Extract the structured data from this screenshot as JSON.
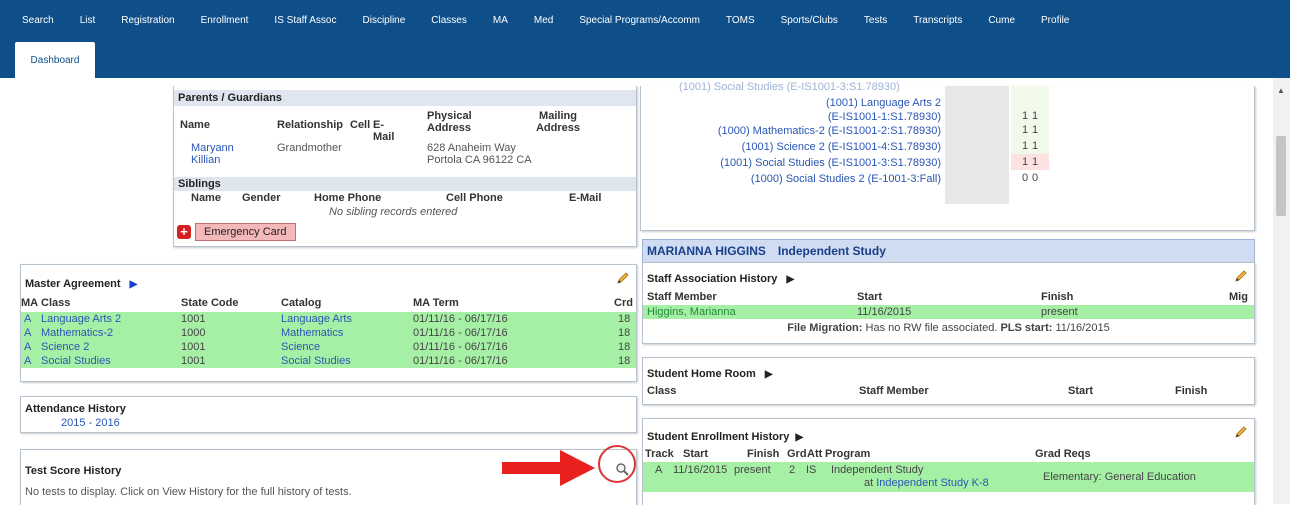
{
  "nav": {
    "items": [
      "Search",
      "List",
      "Registration",
      "Enrollment",
      "IS Staff Assoc",
      "Discipline",
      "Classes",
      "MA",
      "Med",
      "Special Programs/Accomm",
      "TOMS",
      "Sports/Clubs",
      "Tests",
      "Transcripts",
      "Cume",
      "Profile"
    ],
    "active_tab": "Dashboard"
  },
  "parents": {
    "title": "Parents / Guardians",
    "headers": {
      "name": "Name",
      "relationship": "Relationship",
      "cell": "Cell",
      "email": "E-Mail",
      "physical": "Physical Address",
      "mailing": "Mailing Address"
    },
    "row": {
      "name_first": "Maryann",
      "name_last": "Killian",
      "relationship": "Grandmother",
      "addr1": "628 Anaheim Way",
      "addr2": "Portola CA 96122 CA"
    },
    "siblings_title": "Siblings",
    "sib_headers": {
      "name": "Name",
      "gender": "Gender",
      "home": "Home Phone",
      "cell": "Cell Phone",
      "email": "E-Mail"
    },
    "no_siblings": "No sibling records entered",
    "emergency_button": "Emergency Card"
  },
  "attendance_classes": {
    "cut_row": "(1001) Social Studies (E-IS1001-3:S1.78930)",
    "rows": [
      {
        "label1": "(1001) Language Arts 2",
        "label2": "(E-IS1001-1:S1.78930)",
        "vals": [
          "1",
          "1"
        ],
        "status": "green"
      },
      {
        "label1": "(1000) Mathematics-2 (E-IS1001-2:S1.78930)",
        "vals": [
          "1",
          "1"
        ],
        "status": "green"
      },
      {
        "label1": "(1001) Science 2 (E-IS1001-4:S1.78930)",
        "vals": [
          "1",
          "1"
        ],
        "status": "green"
      },
      {
        "label1": "(1001) Social Studies (E-IS1001-3:S1.78930)",
        "vals": [
          "1",
          "1"
        ],
        "status": "green"
      },
      {
        "label1": "(1000) Social Studies 2 (E-1001-3:Fall)",
        "vals": [
          "0",
          "0"
        ],
        "status": "red"
      }
    ]
  },
  "student_banner": {
    "name": "MARIANNA HIGGINS",
    "program": "Independent Study"
  },
  "staff_assoc": {
    "title": "Staff Association History",
    "headers": {
      "member": "Staff Member",
      "start": "Start",
      "finish": "Finish",
      "mig": "Mig"
    },
    "row": {
      "member": "Higgins, Marianna",
      "start": "11/16/2015",
      "finish": "present"
    },
    "migration_label": "File Migration:",
    "migration_text": "Has no RW file associated.",
    "pls_label": "PLS start:",
    "pls_value": "11/16/2015"
  },
  "home_room": {
    "title": "Student Home Room",
    "headers": {
      "class": "Class",
      "member": "Staff Member",
      "start": "Start",
      "finish": "Finish"
    }
  },
  "enrollment": {
    "title": "Student Enrollment History",
    "headers": {
      "track": "Track",
      "start": "Start",
      "finish": "Finish",
      "grd": "Grd",
      "att": "Att",
      "program": "Program",
      "reqs": "Grad Reqs"
    },
    "row": {
      "track": "A",
      "start": "11/16/2015",
      "finish": "present",
      "grd": "2",
      "att": "IS",
      "program1": "Independent Study",
      "program2_prefix": "at ",
      "program2_link": "Independent Study K-8",
      "reqs": "Elementary: General Education"
    }
  },
  "master": {
    "title": "Master Agreement",
    "headers": {
      "ma": "MA",
      "class": "Class",
      "code": "State Code",
      "catalog": "Catalog",
      "term": "MA Term",
      "crd": "Crd"
    },
    "rows": [
      {
        "ma": "A",
        "class": "Language Arts 2",
        "code": "1001",
        "catalog": "Language Arts",
        "term": "01/11/16 - 06/17/16",
        "crd": "18"
      },
      {
        "ma": "A",
        "class": "Mathematics-2",
        "code": "1000",
        "catalog": "Mathematics",
        "term": "01/11/16 - 06/17/16",
        "crd": "18"
      },
      {
        "ma": "A",
        "class": "Science 2",
        "code": "1001",
        "catalog": "Science",
        "term": "01/11/16 - 06/17/16",
        "crd": "18"
      },
      {
        "ma": "A",
        "class": "Social Studies",
        "code": "1001",
        "catalog": "Social Studies",
        "term": "01/11/16 - 06/17/16",
        "crd": "18"
      }
    ]
  },
  "attendance": {
    "title": "Attendance History",
    "year": "2015 - 2016"
  },
  "tests": {
    "title": "Test Score History",
    "message": "No tests to display. Click on View History for the full history of tests."
  },
  "colors": {
    "nav": "#0e4f8a",
    "green": "#a6f0a6",
    "header_band": "#dfe6ef",
    "arrow": "#e8201e",
    "circle": "#d93636"
  }
}
